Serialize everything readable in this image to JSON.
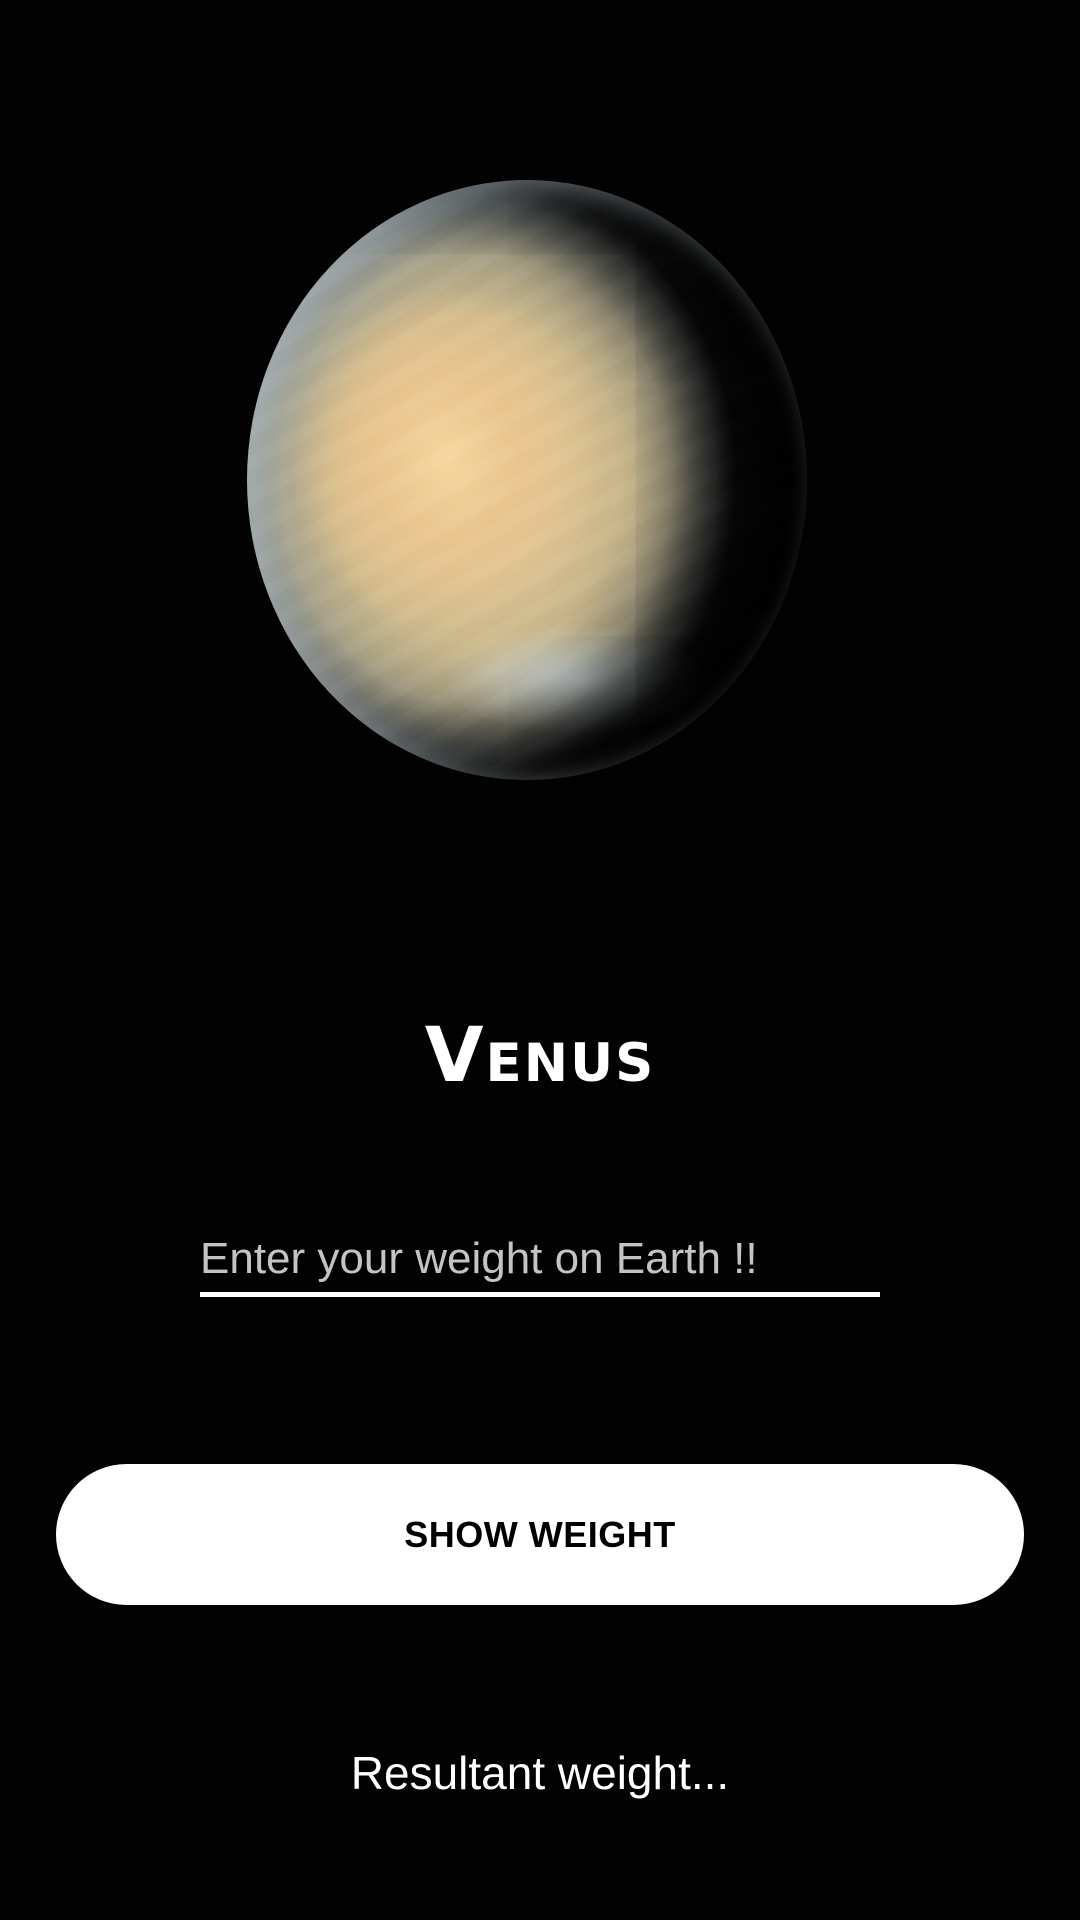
{
  "planet": {
    "image_name": "venus-planet-image",
    "name": "Venus"
  },
  "weight_input": {
    "placeholder": "Enter your weight on Earth !!",
    "value": ""
  },
  "show_button": {
    "label": "SHOW WEIGHT"
  },
  "result": {
    "text": "Resultant weight..."
  },
  "colors": {
    "background": "#020202",
    "text": "#ffffff",
    "placeholder": "#c4c4c4",
    "button_bg": "#ffffff",
    "button_text": "#000000"
  }
}
